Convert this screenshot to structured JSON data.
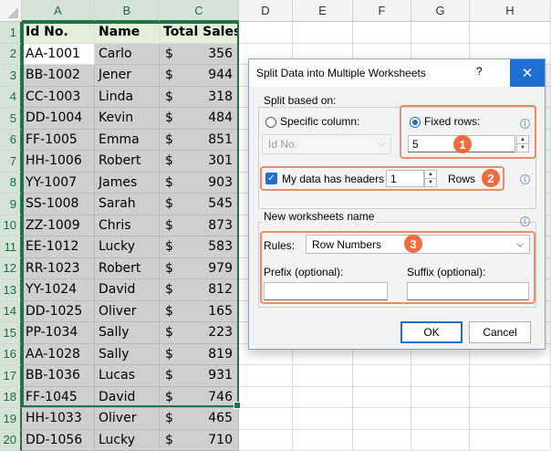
{
  "sheet": {
    "columns": [
      "A",
      "B",
      "C",
      "D",
      "E",
      "F",
      "G",
      "H"
    ],
    "row_numbers": [
      "1",
      "2",
      "3",
      "4",
      "5",
      "6",
      "7",
      "8",
      "9",
      "10",
      "11",
      "12",
      "13",
      "14",
      "15",
      "16",
      "17",
      "18",
      "19",
      "20"
    ],
    "header_cells": [
      "Id No.",
      "Name",
      "Total Sales"
    ],
    "rows": [
      {
        "id": "AA-1001",
        "name": "Carlo",
        "currency": "$",
        "sales": "356"
      },
      {
        "id": "BB-1002",
        "name": "Jener",
        "currency": "$",
        "sales": "944"
      },
      {
        "id": "CC-1003",
        "name": "Linda",
        "currency": "$",
        "sales": "318"
      },
      {
        "id": "DD-1004",
        "name": "Kevin",
        "currency": "$",
        "sales": "484"
      },
      {
        "id": "FF-1005",
        "name": "Emma",
        "currency": "$",
        "sales": "851"
      },
      {
        "id": "HH-1006",
        "name": "Robert",
        "currency": "$",
        "sales": "301"
      },
      {
        "id": "YY-1007",
        "name": "James",
        "currency": "$",
        "sales": "903"
      },
      {
        "id": "SS-1008",
        "name": "Sarah",
        "currency": "$",
        "sales": "545"
      },
      {
        "id": "ZZ-1009",
        "name": "Chris",
        "currency": "$",
        "sales": "873"
      },
      {
        "id": "EE-1012",
        "name": "Lucky",
        "currency": "$",
        "sales": "583"
      },
      {
        "id": "RR-1023",
        "name": "Robert",
        "currency": "$",
        "sales": "979"
      },
      {
        "id": "YY-1024",
        "name": "David",
        "currency": "$",
        "sales": "812"
      },
      {
        "id": "DD-1025",
        "name": "Oliver",
        "currency": "$",
        "sales": "165"
      },
      {
        "id": "PP-1034",
        "name": "Sally",
        "currency": "$",
        "sales": "223"
      },
      {
        "id": "AA-1028",
        "name": "Sally",
        "currency": "$",
        "sales": "819"
      },
      {
        "id": "BB-1036",
        "name": "Lucas",
        "currency": "$",
        "sales": "931"
      },
      {
        "id": "FF-1045",
        "name": "David",
        "currency": "$",
        "sales": "746"
      },
      {
        "id": "HH-1033",
        "name": "Oliver",
        "currency": "$",
        "sales": "465"
      },
      {
        "id": "DD-1056",
        "name": "Lucky",
        "currency": "$",
        "sales": "710"
      }
    ]
  },
  "dialog": {
    "title": "Split Data into Multiple Worksheets",
    "help": "?",
    "close": "✕",
    "split_group": "Split based on:",
    "specific_column_label": "Specific column:",
    "specific_column_value": "Id No.",
    "fixed_rows_label": "Fixed rows:",
    "fixed_rows_value": "5",
    "headers_label": "My data has headers",
    "headers_value": "1",
    "rows_label": "Rows",
    "names_group": "New worksheets name",
    "rules_label": "Rules:",
    "rules_value": "Row Numbers",
    "prefix_label": "Prefix (optional):",
    "suffix_label": "Suffix (optional):",
    "ok": "OK",
    "cancel": "Cancel"
  },
  "annotations": [
    "1",
    "2",
    "3"
  ],
  "colors": {
    "excel_green": "#217346",
    "accent_blue": "#1f6fd0",
    "annotation_orange": "#ef6c3e",
    "highlight_gray": "#cfcfcf",
    "header_green": "#e2efda"
  }
}
